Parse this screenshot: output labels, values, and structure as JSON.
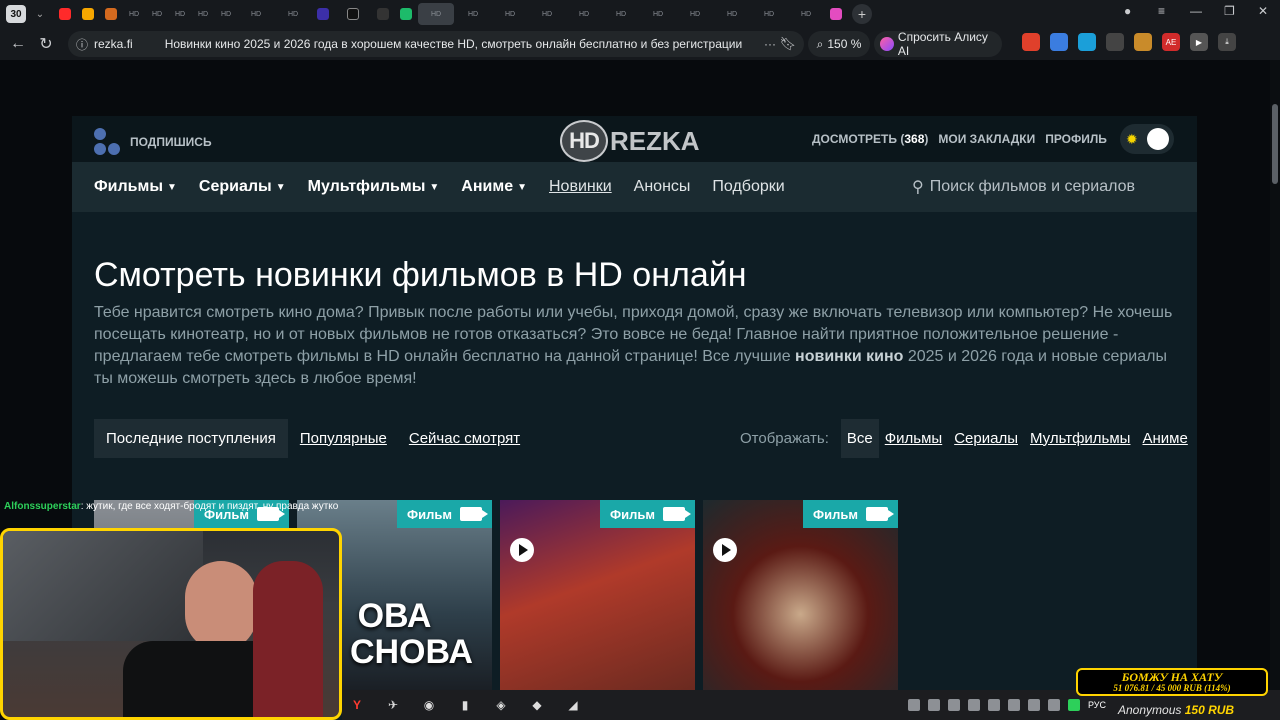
{
  "browser": {
    "tab_count": "30",
    "url_site": "rezka.fi",
    "page_title": "Новинки кино 2025 и 2026 года в хорошем качестве HD, смотреть онлайн бесплатно и без регистрации",
    "zoom": "150 %",
    "alice_label": "Спросить Алису AI"
  },
  "site": {
    "subscribe": "ПОДПИШИСЬ",
    "logo_hd": "HD",
    "logo_rezka": "REZKA",
    "top_links": {
      "watch_label": "ДОСМОТРЕТЬ (",
      "watch_count": "368",
      "watch_close": ")",
      "bookmarks": "МОИ ЗАКЛАДКИ",
      "profile": "ПРОФИЛЬ"
    },
    "nav": {
      "films": "Фильмы",
      "series": "Сериалы",
      "cartoons": "Мультфильмы",
      "anime": "Аниме",
      "new": "Новинки",
      "announce": "Анонсы",
      "collections": "Подборки",
      "search_placeholder": "Поиск фильмов и сериалов"
    },
    "heading": "Смотреть новинки фильмов в HD онлайн",
    "intro_a": "Тебе нравится смотреть кино дома? Привык после работы или учебы, приходя домой, сразу же включать телевизор или компьютер? Не хочешь посещать кинотеатр, но и от новых фильмов не готов отказаться? Это вовсе не беда! Главное найти приятное положительное решение - предлагаем тебе смотреть фильмы в HD онлайн бесплатно на данной странице! Все лучшие ",
    "intro_bold": "новинки кино",
    "intro_b": " 2025 и 2026 года и новые сериалы ты можешь смотреть здесь в любое время!",
    "filters": {
      "latest": "Последние поступления",
      "popular": "Популярные",
      "now_watching": "Сейчас смотрят"
    },
    "show": {
      "label": "Отображать:",
      "all": "Все",
      "films": "Фильмы",
      "series": "Сериалы",
      "cartoons": "Мультфильмы",
      "anime": "Аниме"
    },
    "cards": [
      {
        "badge": "Фильм",
        "poster_text": ""
      },
      {
        "badge": "Фильм",
        "poster_text": "ОВА\nИ СНОВА"
      },
      {
        "badge": "Фильм",
        "poster_text": ""
      },
      {
        "badge": "Фильм",
        "poster_text": ""
      }
    ]
  },
  "stream": {
    "chat_user": "Alfonssuperstar",
    "chat_message": ": жутик, где все ходят-бродят и пиздят, ну правда жутко",
    "donate_title": "БОМЖУ НА ХАТУ",
    "donate_progress": "51 076.81 / 45 000 RUB (114%)",
    "donate_user": "Anonymous",
    "donate_amount": "150 RUB",
    "tray_lang": "РУС"
  },
  "colors": {
    "page_bg": "#070a0d",
    "container_bg": "#0e1d24",
    "nav_bg": "#1b2b31",
    "badge": "#1aa8a8",
    "accent_yellow": "#ffd400"
  }
}
